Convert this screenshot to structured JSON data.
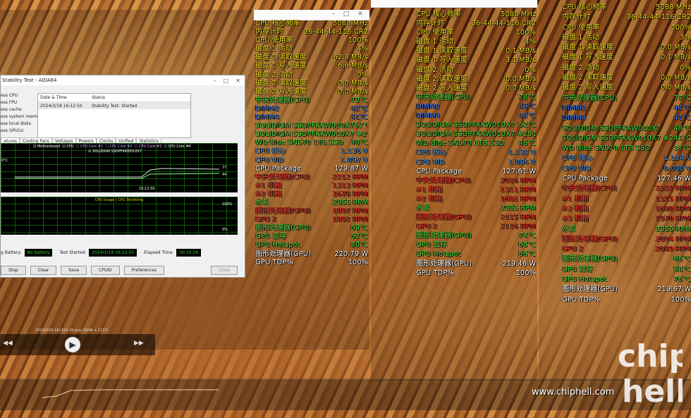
{
  "aida": {
    "title": "Stability Test - AIDA64",
    "options": [
      "ess CPU",
      "ess FPU",
      "ess cache",
      "ess system memory",
      "ess local disks",
      "ess GPU(s)"
    ],
    "status_headers": [
      "Date & Time",
      "Status"
    ],
    "status_row": [
      "2024/3/18 16:12:50",
      "Stability Test: Started"
    ],
    "tabs": [
      "atures",
      "Cooling Fans",
      "Voltages",
      "Powers",
      "Clocks",
      "Unified",
      "Statistics"
    ],
    "graph1_checks": [
      "Motherboard",
      "CPU",
      "CPU Core #1",
      "CPU Core #2",
      "CPU Core #3",
      "CPU Core #4",
      "SOLIDIGM SSDPFKKW010X7"
    ],
    "graph1_left": "0°C",
    "graph1_right1": "77",
    "graph1_right2": "44",
    "graph1_time": "16:12:50",
    "graph2_legend": "CPU Usage | CPU Throttling",
    "graph2_top": "100%",
    "graph2_bot": "0%",
    "battery_label": "g Battery:",
    "battery_val": "No battery",
    "test_started_label": "Test Started:",
    "test_started_val": "2024/3/18 16:12:50",
    "elapsed_label": "Elapsed Time:",
    "elapsed_val": "00:10:26",
    "buttons": [
      "Stop",
      "Clear",
      "Save",
      "CPUID",
      "Preferences",
      "Close"
    ]
  },
  "player": {
    "caption": "20240318 161334 16.png (2048 × 1137)"
  },
  "osd1": [
    {
      "k": "CPU 核心频率",
      "v": "5088 MHz",
      "c": "#f0e020"
    },
    {
      "k": "内存计时",
      "v": "36-44-44-116 CR2",
      "c": "#f0e020"
    },
    {
      "k": "CPU 使用率",
      "v": "100%",
      "c": "#f0e020"
    },
    {
      "k": "磁盘 1 活动",
      "v": "4%",
      "c": "#f0e020"
    },
    {
      "k": "磁盘 1 读取速度",
      "v": "62.8 MB/s",
      "c": "#f0e020"
    },
    {
      "k": "磁盘 1 写入速度",
      "v": "6.6 MB/s",
      "c": "#f0e020"
    },
    {
      "k": "磁盘 2 活动",
      "v": "0%",
      "c": "#f0e020"
    },
    {
      "k": "磁盘 2 读取速度",
      "v": "0.0 MB/s",
      "c": "#f0e020"
    },
    {
      "k": "磁盘 2 写入速度",
      "v": "0.0 MB/s",
      "c": "#f0e020"
    },
    {
      "k": "中央处理器(CPU)",
      "v": "79°C",
      "c": "#40e040"
    },
    {
      "k": "DIMM2",
      "v": "42°C",
      "c": "#4080ff"
    },
    {
      "k": "DIMM4",
      "v": "41°C",
      "c": "#4080ff"
    },
    {
      "k": "SOLIDIGM SSDPFKKW010X7",
      "v": "52°C",
      "c": "#40e040"
    },
    {
      "k": "SOLIDIGM SSDPFKKW010X7 #2",
      "v": "46°C",
      "c": "#40e040"
    },
    {
      "k": "WD Blue SN570 1TB SSD",
      "v": "40°C",
      "c": "#40e040"
    },
    {
      "k": "CPU 核心",
      "v": "1.136 V",
      "c": "#40a0ff"
    },
    {
      "k": "CPU VID",
      "v": "1.097 V",
      "c": "#40a0ff"
    },
    {
      "k": "CPU Package",
      "v": "129.87 W",
      "c": "#ffffff"
    },
    {
      "k": "中央处理器(CPU)",
      "v": "2212 RPM",
      "c": "#ff3030"
    },
    {
      "k": "#1 机箱",
      "v": "1313 RPM",
      "c": "#ff3030"
    },
    {
      "k": "#2 机箱",
      "v": "1678 RPM",
      "c": "#ff3030"
    },
    {
      "k": "水泵",
      "v": "2955 RPM",
      "c": "#40e040"
    },
    {
      "k": "图形处理器(GPU)",
      "v": "1897 RPM",
      "c": "#ff3030"
    },
    {
      "k": "GPU 2",
      "v": "1892 RPM",
      "c": "#ff3030"
    },
    {
      "k": "图形处理器(GPU)",
      "v": "69°C",
      "c": "#40e040"
    },
    {
      "k": "GPU 显存",
      "v": "62°C",
      "c": "#40e040"
    },
    {
      "k": "GPU Hotspot",
      "v": "80°C",
      "c": "#40e040"
    },
    {
      "k": "图形处理器(GPU)",
      "v": "220.79 W",
      "c": "#ffffff"
    },
    {
      "k": "GPU TDP%",
      "v": "100%",
      "c": "#ffffff"
    }
  ],
  "osd2": [
    {
      "k": "CPU 核心频率",
      "v": "5088 MHz",
      "c": "#f0e020"
    },
    {
      "k": "内存计时",
      "v": "36-44-44-116 CR2",
      "c": "#f0e020"
    },
    {
      "k": "CPU 使用率",
      "v": "100%",
      "c": "#f0e020"
    },
    {
      "k": "磁盘 1 活动",
      "v": "4%",
      "c": "#f0e020"
    },
    {
      "k": "磁盘 1 读取速度",
      "v": "0.1 MB/s",
      "c": "#f0e020"
    },
    {
      "k": "磁盘 1 写入速度",
      "v": "3.1 MB/s",
      "c": "#f0e020"
    },
    {
      "k": "磁盘 2 活动",
      "v": "0%",
      "c": "#f0e020"
    },
    {
      "k": "磁盘 2 读取速度",
      "v": "0.0 MB/s",
      "c": "#f0e020"
    },
    {
      "k": "磁盘 2 写入速度",
      "v": "0.0 MB/s",
      "c": "#f0e020"
    },
    {
      "k": "中央处理器(CPU)",
      "v": "78°C",
      "c": "#40e040"
    },
    {
      "k": "DIMM2",
      "v": "45°C",
      "c": "#4080ff"
    },
    {
      "k": "DIMM4",
      "v": "43°C",
      "c": "#4080ff"
    },
    {
      "k": "SOLIDIGM SSDPFKKW010X7",
      "v": "52°C",
      "c": "#40e040"
    },
    {
      "k": "SOLIDIGM SSDPFKKW010X7 #2",
      "v": "51°C",
      "c": "#40e040"
    },
    {
      "k": "WD Blue SN570 1TB SSD",
      "v": "46°C",
      "c": "#40e040"
    },
    {
      "k": "CPU 核心",
      "v": "1.134 V",
      "c": "#40a0ff"
    },
    {
      "k": "CPU VID",
      "v": "1.096 V",
      "c": "#40a0ff"
    },
    {
      "k": "CPU Package",
      "v": "127.61 W",
      "c": "#ffffff"
    },
    {
      "k": "中央处理器(CPU)",
      "v": "2016 RPM",
      "c": "#ff3030"
    },
    {
      "k": "#1 机箱",
      "v": "1311 RPM",
      "c": "#ff3030"
    },
    {
      "k": "#2 机箱",
      "v": "1681 RPM",
      "c": "#ff3030"
    },
    {
      "k": "水泵",
      "v": "2955 RPM",
      "c": "#40e040"
    },
    {
      "k": "图形处理器(GPU)",
      "v": "2115 RPM",
      "c": "#ff3030"
    },
    {
      "k": "GPU 2",
      "v": "2116 RPM",
      "c": "#ff3030"
    },
    {
      "k": "图形处理器(GPU)",
      "v": "74°C",
      "c": "#40e040"
    },
    {
      "k": "GPU 显存",
      "v": "68°C",
      "c": "#40e040"
    },
    {
      "k": "GPU Hotspot",
      "v": "86°C",
      "c": "#40e040"
    },
    {
      "k": "图形处理器(GPU)",
      "v": "219.46 W",
      "c": "#ffffff"
    },
    {
      "k": "GPU TDP%",
      "v": "100%",
      "c": "#ffffff"
    }
  ],
  "osd3": [
    {
      "k": "CPU 核心频率",
      "v": "5088 MHz",
      "c": "#f0e020"
    },
    {
      "k": "内存计时",
      "v": "36-44-44-116 CR2",
      "c": "#f0e020"
    },
    {
      "k": "CPU 使用率",
      "v": "100%",
      "c": "#f0e020"
    },
    {
      "k": "磁盘 1 活动",
      "v": "3%",
      "c": "#f0e020"
    },
    {
      "k": "磁盘 1 读取速度",
      "v": "0.0 MB/s",
      "c": "#f0e020"
    },
    {
      "k": "磁盘 1 写入速度",
      "v": "0.1 MB/s",
      "c": "#f0e020"
    },
    {
      "k": "磁盘 2 活动",
      "v": "0%",
      "c": "#f0e020"
    },
    {
      "k": "磁盘 2 读取速度",
      "v": "0.0 MB/s",
      "c": "#f0e020"
    },
    {
      "k": "磁盘 2 写入速度",
      "v": "0.0 MB/s",
      "c": "#f0e020"
    },
    {
      "k": "中央处理器(CPU)",
      "v": "77°C",
      "c": "#40e040"
    },
    {
      "k": "DIMM2",
      "v": "44°C",
      "c": "#4080ff"
    },
    {
      "k": "DIMM4",
      "v": "41°C",
      "c": "#4080ff"
    },
    {
      "k": "SOLIDIGM SSDPFKKW010X7",
      "v": "48°C",
      "c": "#40e040"
    },
    {
      "k": "SOLIDIGM SSDPFKKW010X7 #2",
      "v": "45°C",
      "c": "#40e040"
    },
    {
      "k": "WD Blue SN570 1TB SSD",
      "v": "37°C",
      "c": "#40e040"
    },
    {
      "k": "CPU 核心",
      "v": "1.134 V",
      "c": "#40a0ff"
    },
    {
      "k": "CPU VID",
      "v": "0.000 V",
      "c": "#40a0ff"
    },
    {
      "k": "CPU Package",
      "v": "127.46 W",
      "c": "#ffffff"
    },
    {
      "k": "中央处理器(CPU)",
      "v": "2222 RPM",
      "c": "#ff3030"
    },
    {
      "k": "#1 机箱",
      "v": "1315 RPM",
      "c": "#ff3030"
    },
    {
      "k": "#2 机箱",
      "v": "1680 RPM",
      "c": "#ff3030"
    },
    {
      "k": "#3 机箱",
      "v": "1970 RPM",
      "c": "#ff3030"
    },
    {
      "k": "水泵",
      "v": "2955 RPM",
      "c": "#40e040"
    },
    {
      "k": "图形处理器(GPU)",
      "v": "2094 RPM",
      "c": "#ff3030"
    },
    {
      "k": "GPU 2",
      "v": "2089 RPM",
      "c": "#ff3030"
    },
    {
      "k": "图形处理器(GPU)",
      "v": "66°C",
      "c": "#40e040"
    },
    {
      "k": "GPU 显存",
      "v": "58°C",
      "c": "#40e040"
    },
    {
      "k": "GPU Hotspot",
      "v": "76°C",
      "c": "#40e040"
    },
    {
      "k": "图形处理器(GPU)",
      "v": "219.67 W",
      "c": "#ffffff"
    },
    {
      "k": "GPU TDP%",
      "v": "100%",
      "c": "#ffffff"
    }
  ],
  "watermark": {
    "url": "www.chiphell.com",
    "logo": "chip hell"
  }
}
